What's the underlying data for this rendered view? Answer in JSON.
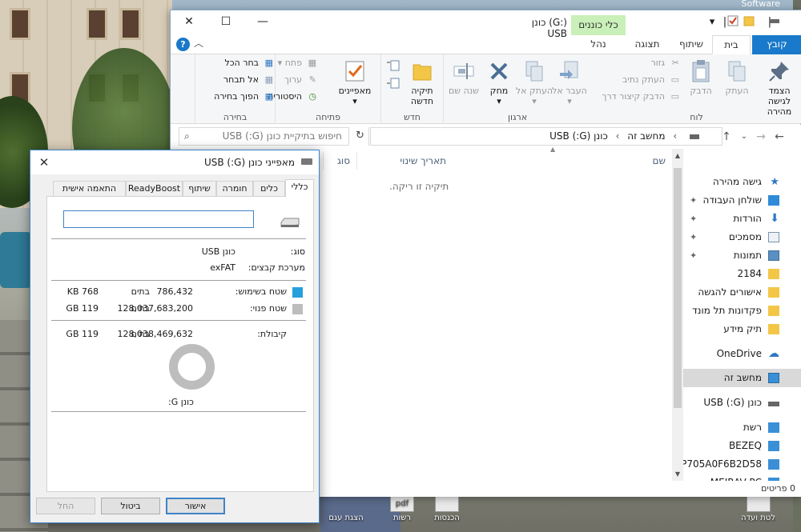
{
  "desktop": {
    "corner_label": "Software",
    "icons": [
      {
        "label": "pdf",
        "caption": "רשות"
      },
      {
        "label": "",
        "caption": "הכנסות"
      },
      {
        "label": "",
        "caption": "הצגת עגם"
      },
      {
        "label": "",
        "caption": "החלטת ועדה"
      }
    ]
  },
  "explorer": {
    "title": "כונן (G:) USB",
    "context_tab": "כלי כוננים",
    "controls": {
      "minimize": "—",
      "maximize": "☐",
      "close": "✕"
    },
    "tabs": {
      "file": "קובץ",
      "home": "בית",
      "share": "שיתוף",
      "view": "תצוגה",
      "manage": "נהל"
    },
    "ribbon": {
      "clipboard": {
        "group": "לוח",
        "pin": "הצמד לגישה מהירה",
        "copy": "העתק",
        "paste": "הדבק",
        "cut": "גזור",
        "copy_path": "העתק נתיב",
        "paste_shortcut": "הדבק קיצור דרך"
      },
      "organize": {
        "group": "ארגון",
        "move_to": "העבר אל",
        "copy_to": "העתק אל",
        "delete": "מחק",
        "rename": "שנה שם"
      },
      "new": {
        "group": "חדש",
        "new_folder": "תיקיה חדשה"
      },
      "open": {
        "group": "פתיחה",
        "properties": "מאפיינים",
        "open": "פתח",
        "edit": "ערוך",
        "history": "היסטוריה"
      },
      "select": {
        "group": "בחירה",
        "select_all": "בחר הכל",
        "select_none": "אל תבחר",
        "invert": "הפוך בחירה"
      }
    },
    "address": {
      "crumb1": "מחשב זה",
      "crumb2": "כונן (G:) USB",
      "search_placeholder": "חיפוש בתיקיית כונן (G:) USB"
    },
    "columns": {
      "name": "שם",
      "date": "תאריך שינוי",
      "type": "סוג"
    },
    "empty_message": "תיקיה זו ריקה.",
    "nav": {
      "quick_access": "גישה מהירה",
      "items": [
        {
          "label": "שולחן העבודה",
          "pinned": true,
          "icon": "desktop-icon"
        },
        {
          "label": "הורדות",
          "pinned": true,
          "icon": "download-icon"
        },
        {
          "label": "מסמכים",
          "pinned": true,
          "icon": "documents-icon"
        },
        {
          "label": "תמונות",
          "pinned": true,
          "icon": "pictures-icon"
        },
        {
          "label": "2184",
          "pinned": false,
          "icon": "folder-icon"
        },
        {
          "label": "אישורים להגשה",
          "pinned": false,
          "icon": "folder-icon"
        },
        {
          "label": "פקדונות תל מונד",
          "pinned": false,
          "icon": "folder-icon"
        },
        {
          "label": "תיק מידע",
          "pinned": false,
          "icon": "folder-icon"
        }
      ],
      "onedrive": "OneDrive",
      "this_pc": "מחשב זה",
      "usb": "כונן (G:) USB",
      "network": "רשת",
      "computers": [
        "BEZEQ",
        "IP705A0F6B2D58",
        "MEIRAV-PC"
      ]
    },
    "status": "0 פריטים"
  },
  "dialog": {
    "title": "מאפייני כונן (G:) USB",
    "close": "✕",
    "tabs": [
      "כללי",
      "כלים",
      "חומרה",
      "שיתוף",
      "ReadyBoost",
      "התאמה אישית"
    ],
    "name_value": "",
    "type_label": "סוג:",
    "type_value": "כונן USB",
    "fs_label": "מערכת קבצים:",
    "fs_value": "exFAT",
    "used_label": "שטח בשימוש:",
    "used_bytes": "786,432",
    "used_size": "768 KB",
    "free_label": "שטח פנוי:",
    "free_bytes": "128,037,683,200",
    "free_size": "119 GB",
    "capacity_label": "קיבולת:",
    "capacity_bytes": "128,038,469,632",
    "capacity_size": "119 GB",
    "bytes_word": "בתים",
    "drive_label": "כונן G:",
    "buttons": {
      "ok": "אישור",
      "cancel": "ביטול",
      "apply": "החל"
    },
    "colors": {
      "used": "#26a0da",
      "free": "#bdbdbd",
      "accent": "#3e84c7"
    },
    "used_fraction": 6e-06
  }
}
